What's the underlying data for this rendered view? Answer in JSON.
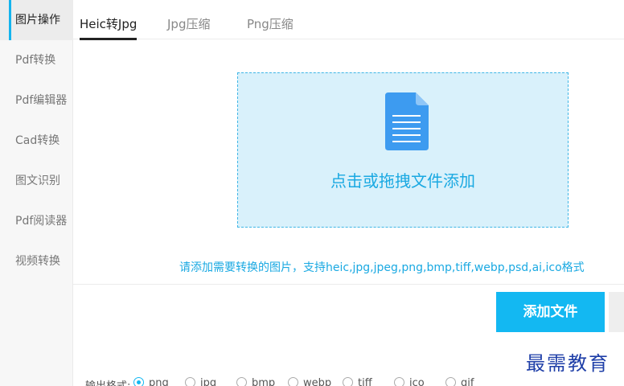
{
  "sidebar": {
    "items": [
      {
        "label": "图片操作",
        "active": true
      },
      {
        "label": "Pdf转换"
      },
      {
        "label": "Pdf编辑器"
      },
      {
        "label": "Cad转换"
      },
      {
        "label": "图文识别"
      },
      {
        "label": "Pdf阅读器"
      },
      {
        "label": "视频转换"
      }
    ]
  },
  "tabs": [
    {
      "label": "Heic转Jpg",
      "active": true
    },
    {
      "label": "Jpg压缩"
    },
    {
      "label": "Png压缩"
    }
  ],
  "dropzone": {
    "text": "点击或拖拽文件添加",
    "icon": "document-icon"
  },
  "hint": "请添加需要转换的图片，支持heic,jpg,jpeg,png,bmp,tiff,webp,psd,ai,ico格式",
  "actions": {
    "add_file_label": "添加文件"
  },
  "watermark": "最需教育",
  "output_format": {
    "label": "输出格式:",
    "options": [
      "png",
      "jpg",
      "bmp",
      "webp",
      "tiff",
      "ico",
      "gif"
    ],
    "selected": "png"
  },
  "colors": {
    "accent": "#13b8f2",
    "dropzone_bg": "#d9f1fb",
    "watermark": "#1f3fa8"
  }
}
